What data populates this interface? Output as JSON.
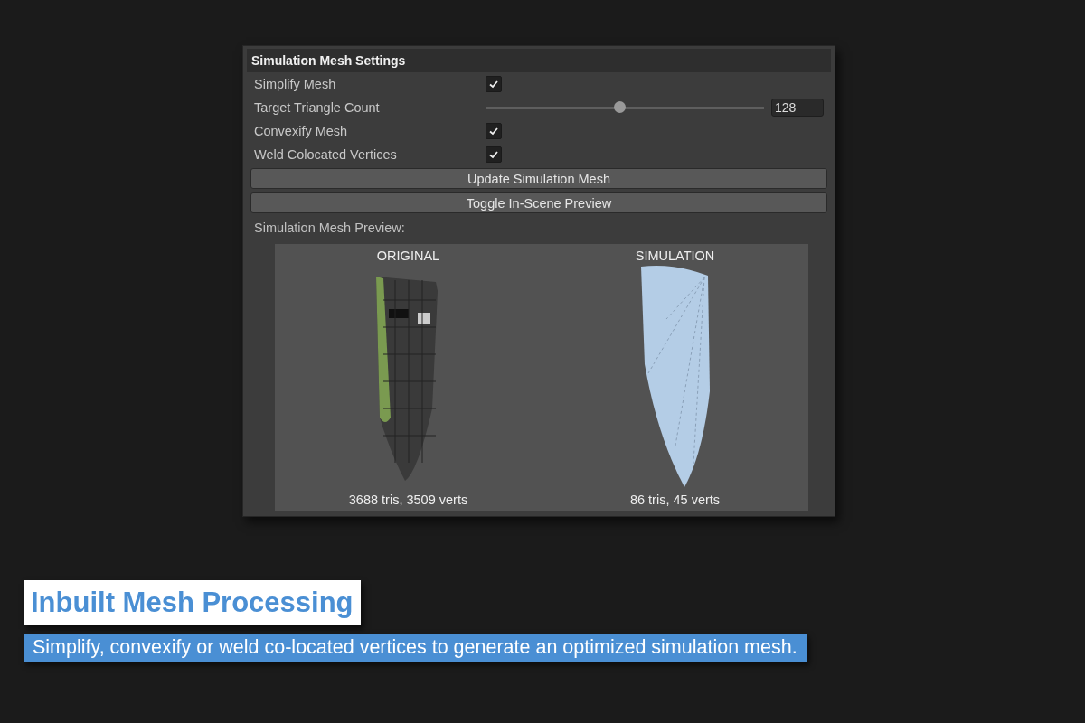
{
  "panel": {
    "title": "Simulation Mesh Settings",
    "fields": [
      {
        "kind": "checkbox",
        "label": "Simplify Mesh",
        "checked": true
      },
      {
        "kind": "slider",
        "label": "Target Triangle Count",
        "level": 0.48,
        "value": "128"
      },
      {
        "kind": "checkbox",
        "label": "Convexify Mesh",
        "checked": true
      },
      {
        "kind": "checkbox",
        "label": "Weld Colocated Vertices",
        "checked": true
      }
    ],
    "buttons": [
      "Update Simulation Mesh",
      "Toggle In-Scene Preview"
    ],
    "preview_label": "Simulation Mesh Preview:",
    "previews": [
      {
        "kind": "original",
        "title": "ORIGINAL",
        "stats": "3688 tris, 3509 verts"
      },
      {
        "kind": "simulation",
        "title": "SIMULATION",
        "stats": "86 tris, 45 verts"
      }
    ]
  },
  "caption": {
    "headline": "Inbuilt Mesh Processing",
    "subtitle": "Simplify, convexify or weld co-located vertices to generate an optimized simulation mesh."
  }
}
